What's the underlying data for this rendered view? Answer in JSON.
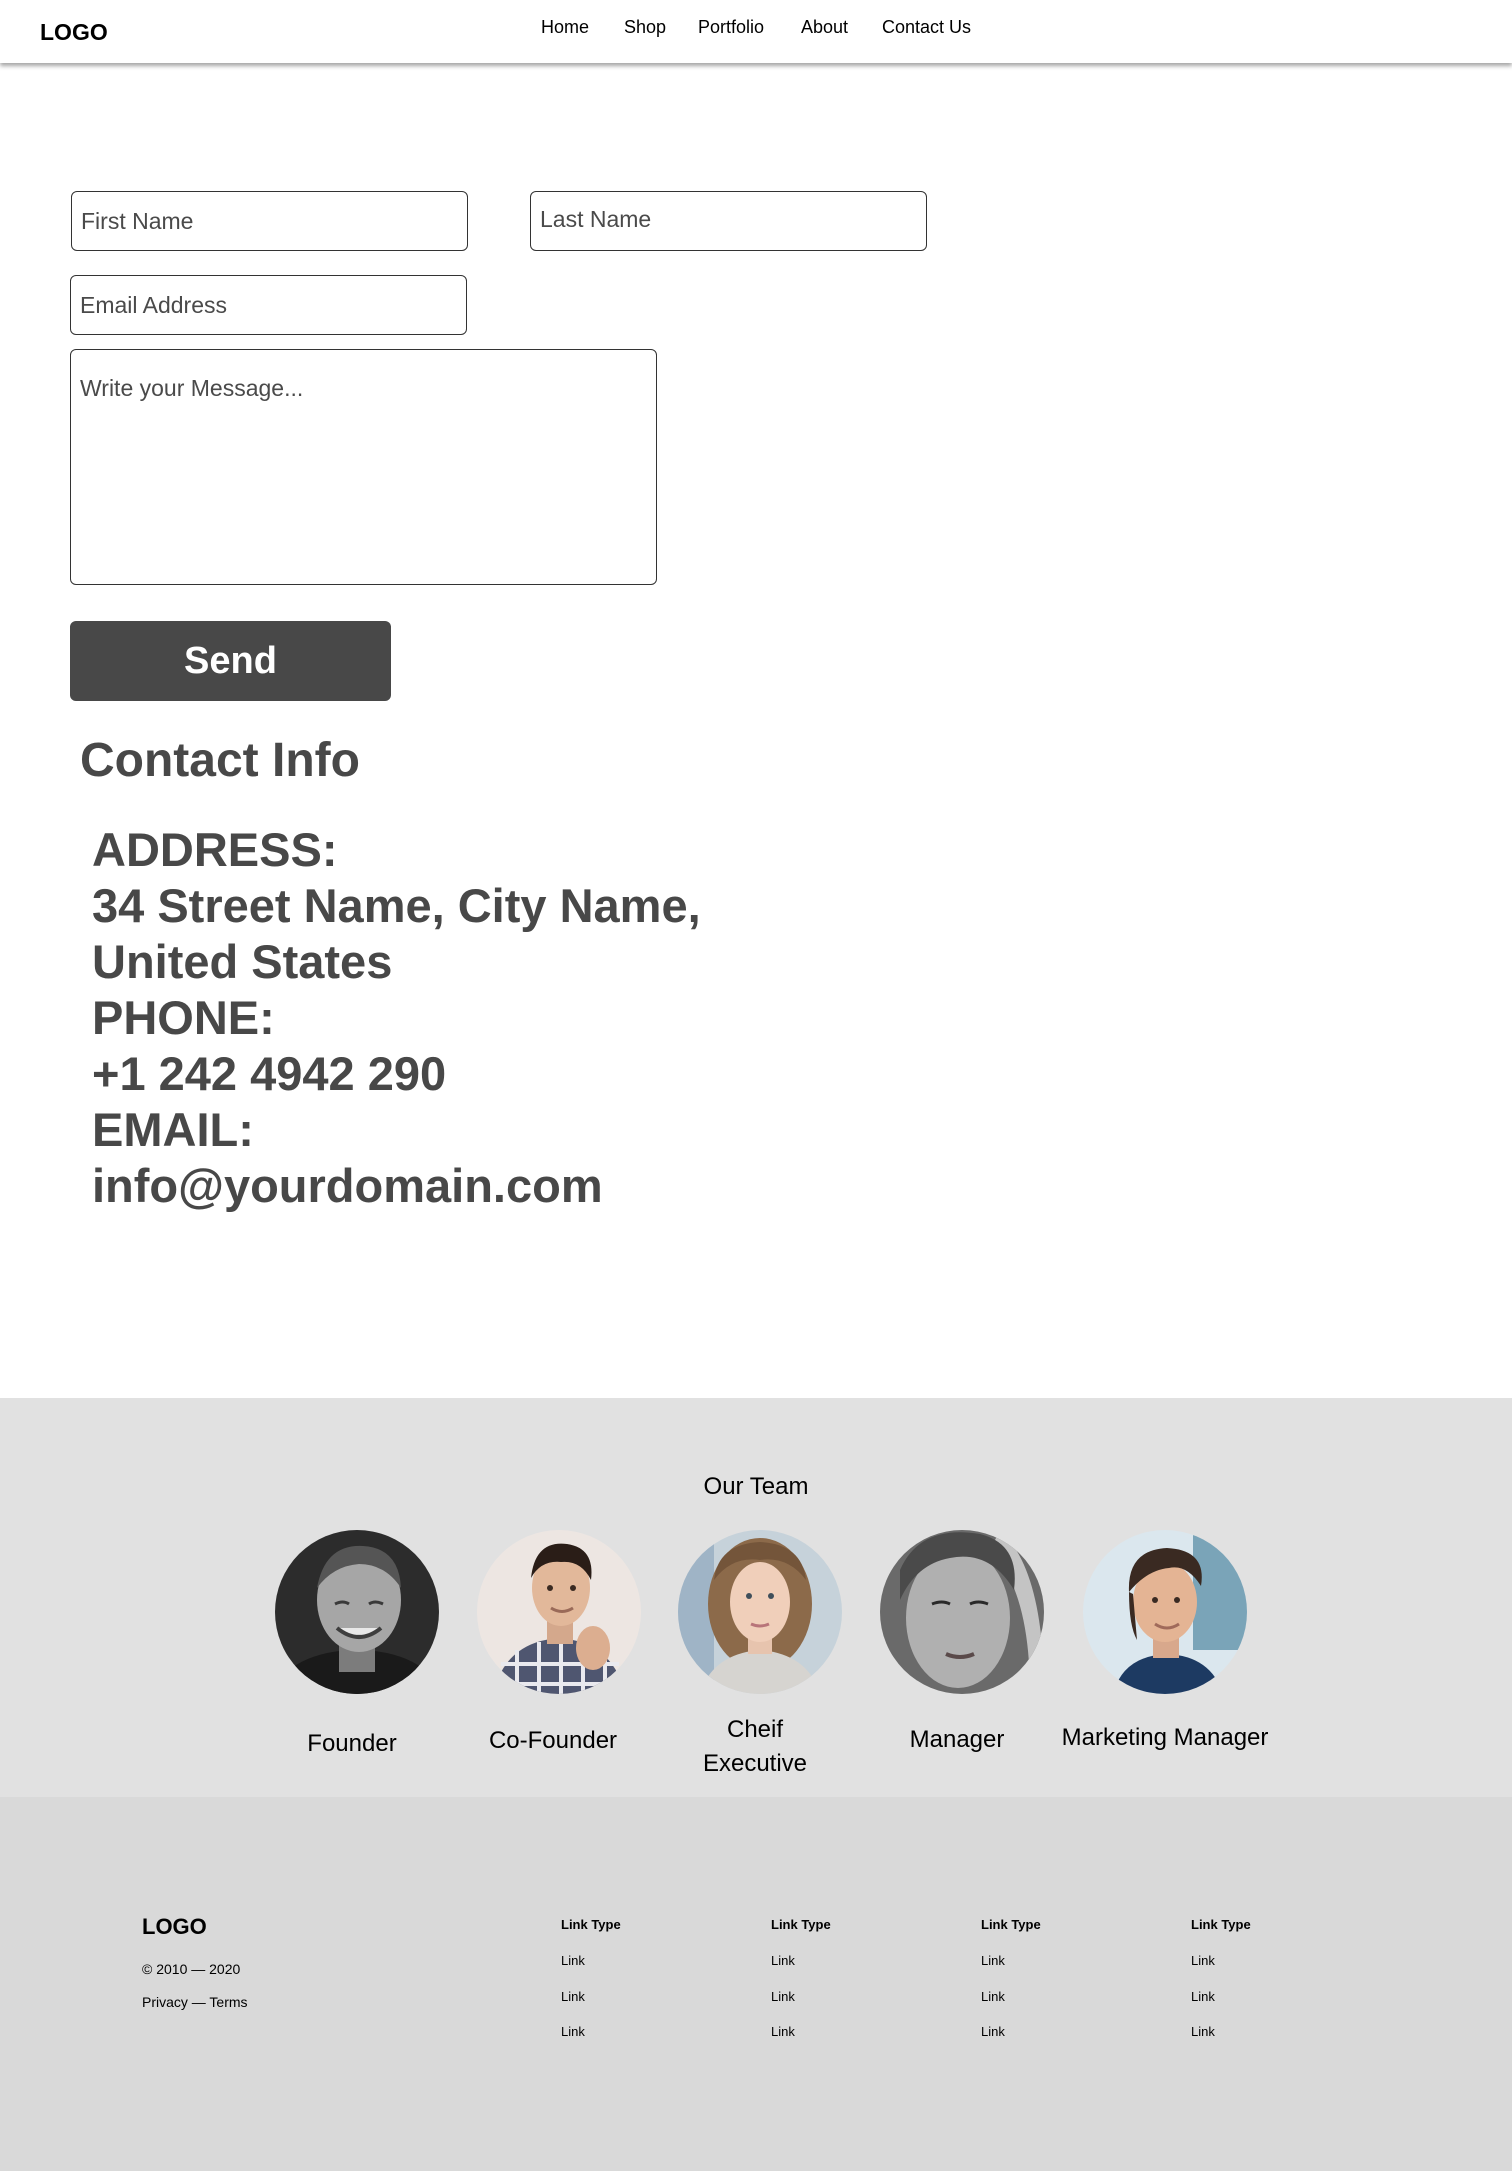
{
  "header": {
    "logo": "LOGO",
    "nav": [
      "Home",
      "Shop",
      "Portfolio",
      "About",
      "Contact Us"
    ]
  },
  "form": {
    "first_name_placeholder": "First Name",
    "last_name_placeholder": "Last Name",
    "email_placeholder": "Email Address",
    "message_placeholder": "Write your Message...",
    "send_label": "Send"
  },
  "contact": {
    "title": "Contact Info",
    "lines": [
      "ADDRESS:",
      "34 Street Name, City Name,",
      "United States",
      "PHONE:",
      "+1 242 4942 290",
      "EMAIL:",
      "info@yourdomain.com"
    ]
  },
  "team": {
    "title": "Our Team",
    "members": [
      {
        "role": "Founder"
      },
      {
        "role": "Co-Founder"
      },
      {
        "role_line1": "Cheif",
        "role_line2": "Executive"
      },
      {
        "role": "Manager"
      },
      {
        "role": "Marketing Manager"
      }
    ]
  },
  "footer": {
    "logo": "LOGO",
    "copyright": "© 2010 — 2020",
    "privacy_terms": "Privacy — Terms",
    "columns": [
      {
        "heading": "Link Type",
        "links": [
          "Link",
          "Link",
          "Link"
        ]
      },
      {
        "heading": "Link Type",
        "links": [
          "Link",
          "Link",
          "Link"
        ]
      },
      {
        "heading": "Link Type",
        "links": [
          "Link",
          "Link",
          "Link"
        ]
      },
      {
        "heading": "Link Type",
        "links": [
          "Link",
          "Link",
          "Link"
        ]
      }
    ]
  },
  "colors": {
    "button_bg": "#484848",
    "heading_text": "#484848",
    "team_bg": "#e1e1e1",
    "footer_bg": "#d9d9d9"
  }
}
